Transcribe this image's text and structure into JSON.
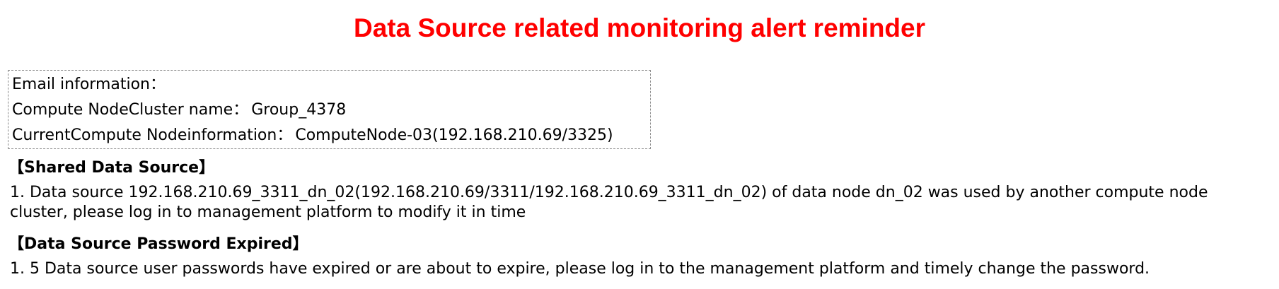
{
  "title": {
    "text": "Data Source related monitoring alert reminder",
    "color": "#ff0000"
  },
  "email_info": {
    "heading": "Email information",
    "separator": "：",
    "cluster_label": "Compute NodeCluster name",
    "cluster_value": "Group_4378",
    "node_label": "CurrentCompute Nodeinformation",
    "node_value": "ComputeNode-03(192.168.210.69/3325)"
  },
  "sections": [
    {
      "heading": "【Shared Data Source】",
      "items": [
        "1. Data source 192.168.210.69_3311_dn_02(192.168.210.69/3311/192.168.210.69_3311_dn_02) of data node dn_02 was used by another compute node cluster, please log in to management platform to modify it in time"
      ]
    },
    {
      "heading": "【Data Source Password Expired】",
      "items": [
        "1. 5 Data source user passwords have expired or are about to expire, please log in to the management platform and timely change the password."
      ]
    }
  ]
}
